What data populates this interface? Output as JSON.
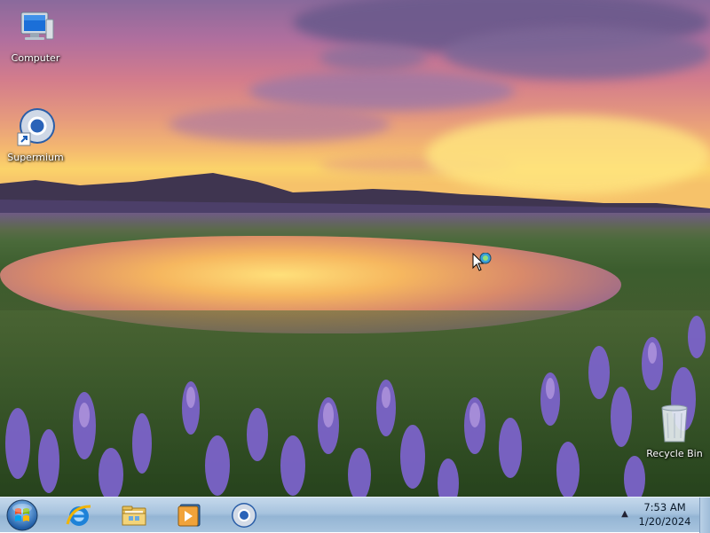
{
  "desktop": {
    "icons": [
      {
        "label": "Computer",
        "icon": "computer-icon"
      },
      {
        "label": "Supermium",
        "icon": "supermium-browser-icon"
      },
      {
        "label": "Recycle Bin",
        "icon": "recycle-bin-icon"
      }
    ],
    "wallpaper": "sunset lake with purple wildflowers"
  },
  "taskbar": {
    "start": {
      "icon": "windows-start-orb-icon"
    },
    "pinned": [
      {
        "name": "Internet Explorer",
        "icon": "internet-explorer-icon"
      },
      {
        "name": "File Explorer",
        "icon": "file-explorer-folder-icon"
      },
      {
        "name": "Windows Media Player",
        "icon": "media-player-icon"
      },
      {
        "name": "Supermium",
        "icon": "supermium-browser-icon"
      }
    ],
    "tray": {
      "chevron": "▲",
      "time": "7:53 AM",
      "date": "1/20/2024"
    }
  },
  "colors": {
    "taskbar": "#a7c3de",
    "sky_top": "#8a6a9c",
    "sunset": "#fbd36a",
    "flowers": "#7a62c9"
  }
}
